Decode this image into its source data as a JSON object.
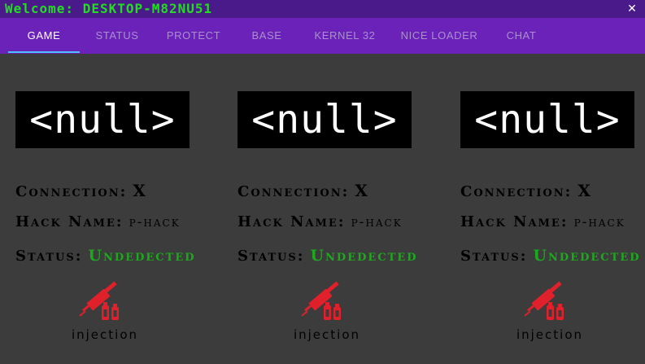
{
  "window": {
    "title": "Welcome: DESKTOP-M82NU51",
    "close_glyph": "✕"
  },
  "tabs": [
    {
      "label": "GAME",
      "active": true
    },
    {
      "label": "STATUS",
      "active": false
    },
    {
      "label": "PROTECT",
      "active": false
    },
    {
      "label": "BASE",
      "active": false
    },
    {
      "label": "KERNEL 32",
      "active": false
    },
    {
      "label": "NICE LOADER",
      "active": false
    },
    {
      "label": "CHAT",
      "active": false
    }
  ],
  "cards": [
    {
      "image_text": "<null>",
      "connection_label": "Connection:",
      "connection_value": "X",
      "hack_name_label": "Hack Name:",
      "hack_name_value": "p-hack",
      "status_label": "Status:",
      "status_value": "Undedected",
      "action_label": "injection",
      "action_icon": "syringe-icon"
    },
    {
      "image_text": "<null>",
      "connection_label": "Connection:",
      "connection_value": "X",
      "hack_name_label": "Hack Name:",
      "hack_name_value": "p-hack",
      "status_label": "Status:",
      "status_value": "Undedected",
      "action_label": "injection",
      "action_icon": "syringe-icon"
    },
    {
      "image_text": "<null>",
      "connection_label": "Connection:",
      "connection_value": "X",
      "hack_name_label": "Hack Name:",
      "hack_name_value": "p-hack",
      "status_label": "Status:",
      "status_value": "Undedected",
      "action_label": "injection",
      "action_icon": "syringe-icon"
    }
  ],
  "colors": {
    "titlebar": "#4a1a8a",
    "tabbar": "#6a22b8",
    "background": "#3c3c3c",
    "title_text": "#22dd22",
    "status_ok": "#1ea81e",
    "icon_red": "#e0202a",
    "tab_indicator": "#4fc3f7"
  }
}
